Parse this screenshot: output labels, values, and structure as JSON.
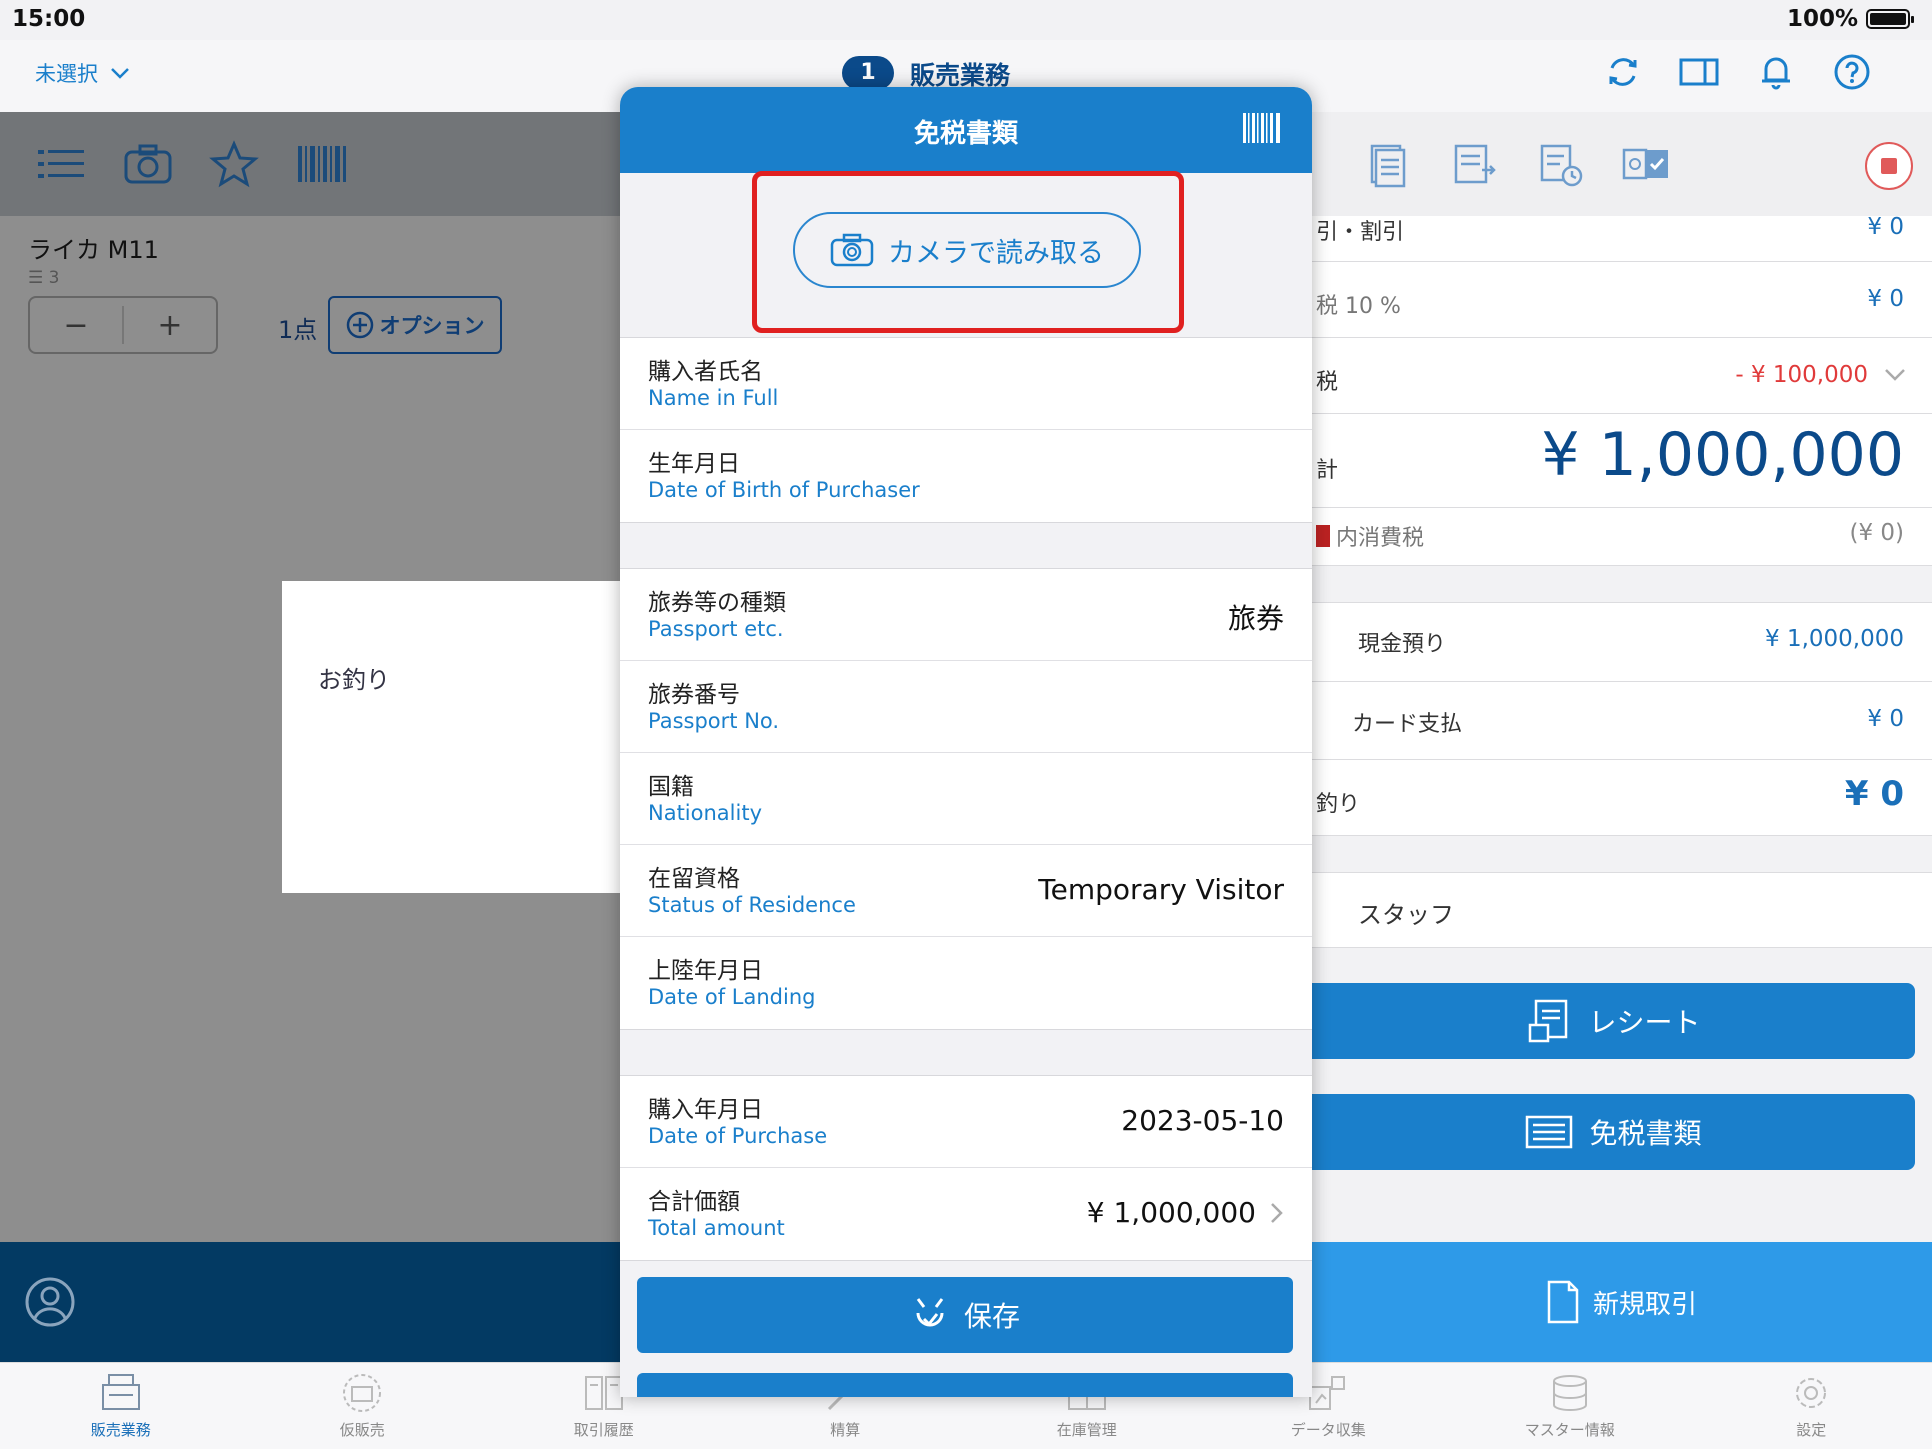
{
  "status": {
    "time": "15:00",
    "battery": "100%"
  },
  "nav": {
    "left_label": "未選択",
    "badge": "1",
    "title": "販売業務"
  },
  "left": {
    "item_name": "ライカ M11",
    "item_sub": "☰ 3",
    "minus": "−",
    "plus": "+",
    "qty": "1点",
    "option_label": "オプション",
    "change_label": "お釣り"
  },
  "right": {
    "rows": [
      {
        "label": "引・割引",
        "value": "¥ 0"
      },
      {
        "label": "税 10 %",
        "value": "¥ 0"
      },
      {
        "label": "税",
        "value": "- ¥ 100,000"
      },
      {
        "label": "計",
        "value": "¥ 1,000,000"
      },
      {
        "label": "内消費税",
        "value": "(¥ 0)"
      }
    ],
    "payments": [
      {
        "label": "現金預り",
        "value": "¥ 1,000,000"
      },
      {
        "label": "カード支払",
        "value": "¥ 0"
      },
      {
        "label": "釣り",
        "value": "¥ 0"
      }
    ],
    "staff_label": "スタッフ",
    "receipt_button": "レシート",
    "taxfree_button": "免税書類",
    "new_transaction": "新規取引",
    "colors": {
      "accent": "#1a7fcb",
      "negative": "#e03a3a"
    }
  },
  "modal": {
    "title": "免税書類",
    "camera_button": "カメラで読み取る",
    "group1": [
      {
        "jp": "購入者氏名",
        "en": "Name in Full",
        "value": ""
      },
      {
        "jp": "生年月日",
        "en": "Date of Birth of Purchaser",
        "value": ""
      }
    ],
    "group2": [
      {
        "jp": "旅券等の種類",
        "en": "Passport etc.",
        "value": "旅券"
      },
      {
        "jp": "旅券番号",
        "en": "Passport No.",
        "value": ""
      },
      {
        "jp": "国籍",
        "en": "Nationality",
        "value": ""
      },
      {
        "jp": "在留資格",
        "en": "Status of Residence",
        "value": "Temporary Visitor"
      },
      {
        "jp": "上陸年月日",
        "en": "Date of Landing",
        "value": ""
      }
    ],
    "group3": [
      {
        "jp": "購入年月日",
        "en": "Date of Purchase",
        "value": "2023-05-10"
      },
      {
        "jp": "合計価額",
        "en": "Total amount",
        "value": "¥ 1,000,000"
      }
    ],
    "save_button": "保存"
  },
  "tabs": [
    {
      "label": "販売業務",
      "icon": "register-icon"
    },
    {
      "label": "仮販売",
      "icon": "temp-sale-icon"
    },
    {
      "label": "取引履歴",
      "icon": "history-icon"
    },
    {
      "label": "精算",
      "icon": "settlement-icon"
    },
    {
      "label": "在庫管理",
      "icon": "inventory-icon"
    },
    {
      "label": "データ収集",
      "icon": "data-collection-icon"
    },
    {
      "label": "マスター情報",
      "icon": "master-info-icon"
    },
    {
      "label": "設定",
      "icon": "settings-icon"
    }
  ]
}
